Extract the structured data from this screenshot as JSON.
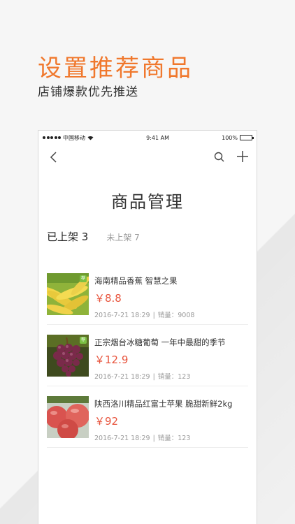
{
  "promo": {
    "headline": "设置推荐商品",
    "subline": "店铺爆款优先推送"
  },
  "statusbar": {
    "carrier": "中国移动",
    "time": "9:41 AM",
    "battery": "100%"
  },
  "page": {
    "title": "商品管理"
  },
  "tabs": {
    "listed": "已上架 3",
    "unlisted": "未上架 7"
  },
  "products": [
    {
      "name": "海南精品香蕉 智慧之果",
      "price": "￥8.8",
      "date": "2016-7-21 18:29",
      "sales": "销量：9008",
      "image": "banana-image"
    },
    {
      "name": "正宗烟台冰糖葡萄 一年中最甜的季节",
      "price": "￥12.9",
      "date": "2016-7-21 18:29",
      "sales": "销量：123",
      "image": "grape-image"
    },
    {
      "name": "陕西洛川精品红富士苹果 脆甜新鲜2kg",
      "price": "￥92",
      "date": "2016-7-21 18:29",
      "sales": "销量：123",
      "image": "apple-image"
    }
  ],
  "colors": {
    "accent": "#f0782d",
    "price": "#e8553e"
  }
}
